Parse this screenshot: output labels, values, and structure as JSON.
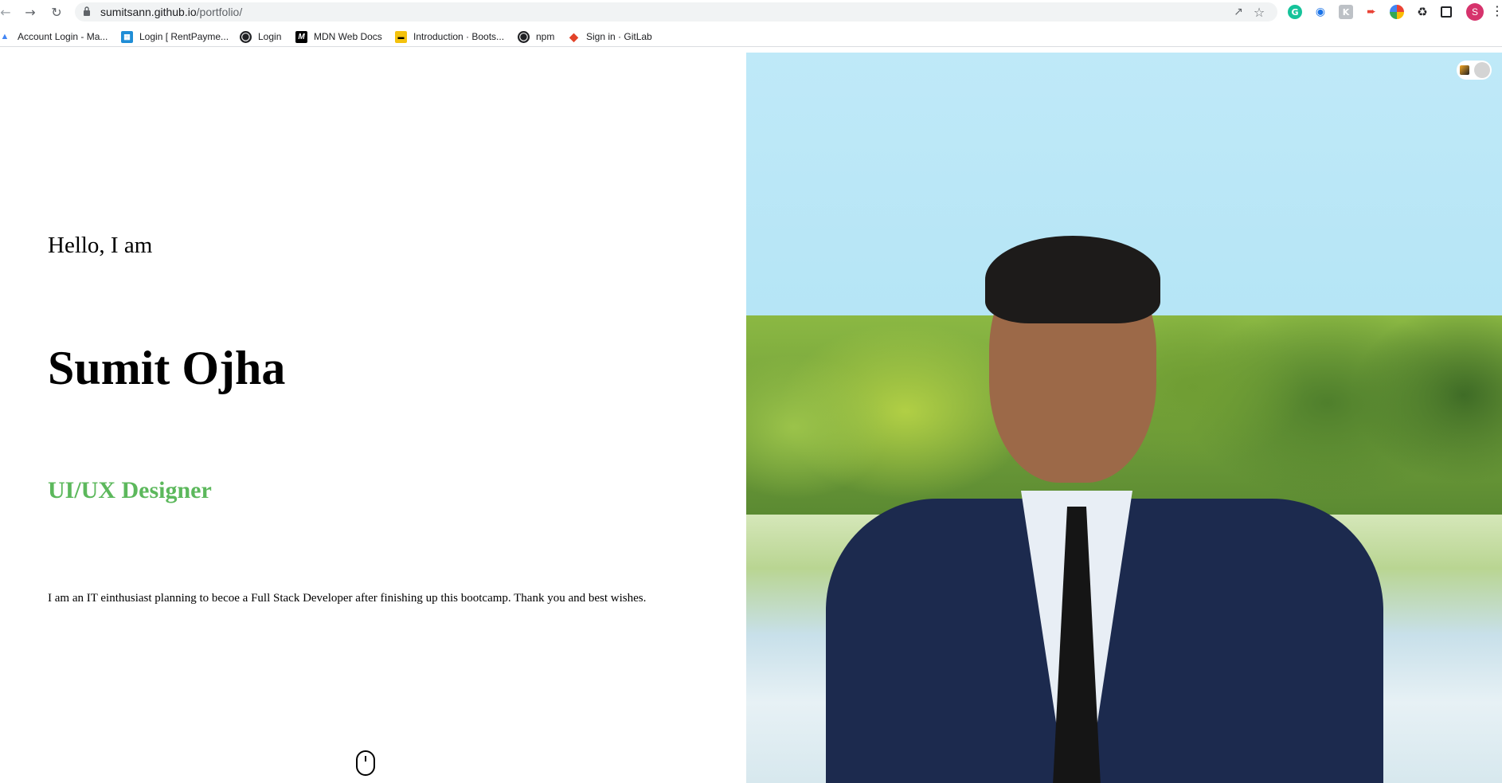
{
  "browser": {
    "url_host": "sumitsann.github.io",
    "url_path": "/portfolio/",
    "avatar_letter": "S",
    "icons": [
      "back-icon",
      "forward-icon",
      "reload-icon",
      "lock-icon",
      "share-icon",
      "star-icon",
      "grammarly-icon",
      "extension-icon",
      "puzzle-icon",
      "side-panel-icon",
      "menu-icon"
    ]
  },
  "bookmarks": [
    {
      "label": "Account Login - Ma..."
    },
    {
      "label": "Login [ RentPayme..."
    },
    {
      "label": "Login"
    },
    {
      "label": "MDN Web Docs"
    },
    {
      "label": "Introduction · Boots..."
    },
    {
      "label": "npm"
    },
    {
      "label": "Sign in · GitLab"
    }
  ],
  "hero": {
    "greeting": "Hello, I am",
    "name": "Sumit Ojha",
    "role": "UI/UX Designer",
    "bio": "I am an IT einthusiast planning to becoe a Full Stack Developer after finishing up this bootcamp. Thank you and best wishes."
  },
  "colors": {
    "role_accent": "#5cb85c",
    "avatar": "#d6336c"
  }
}
